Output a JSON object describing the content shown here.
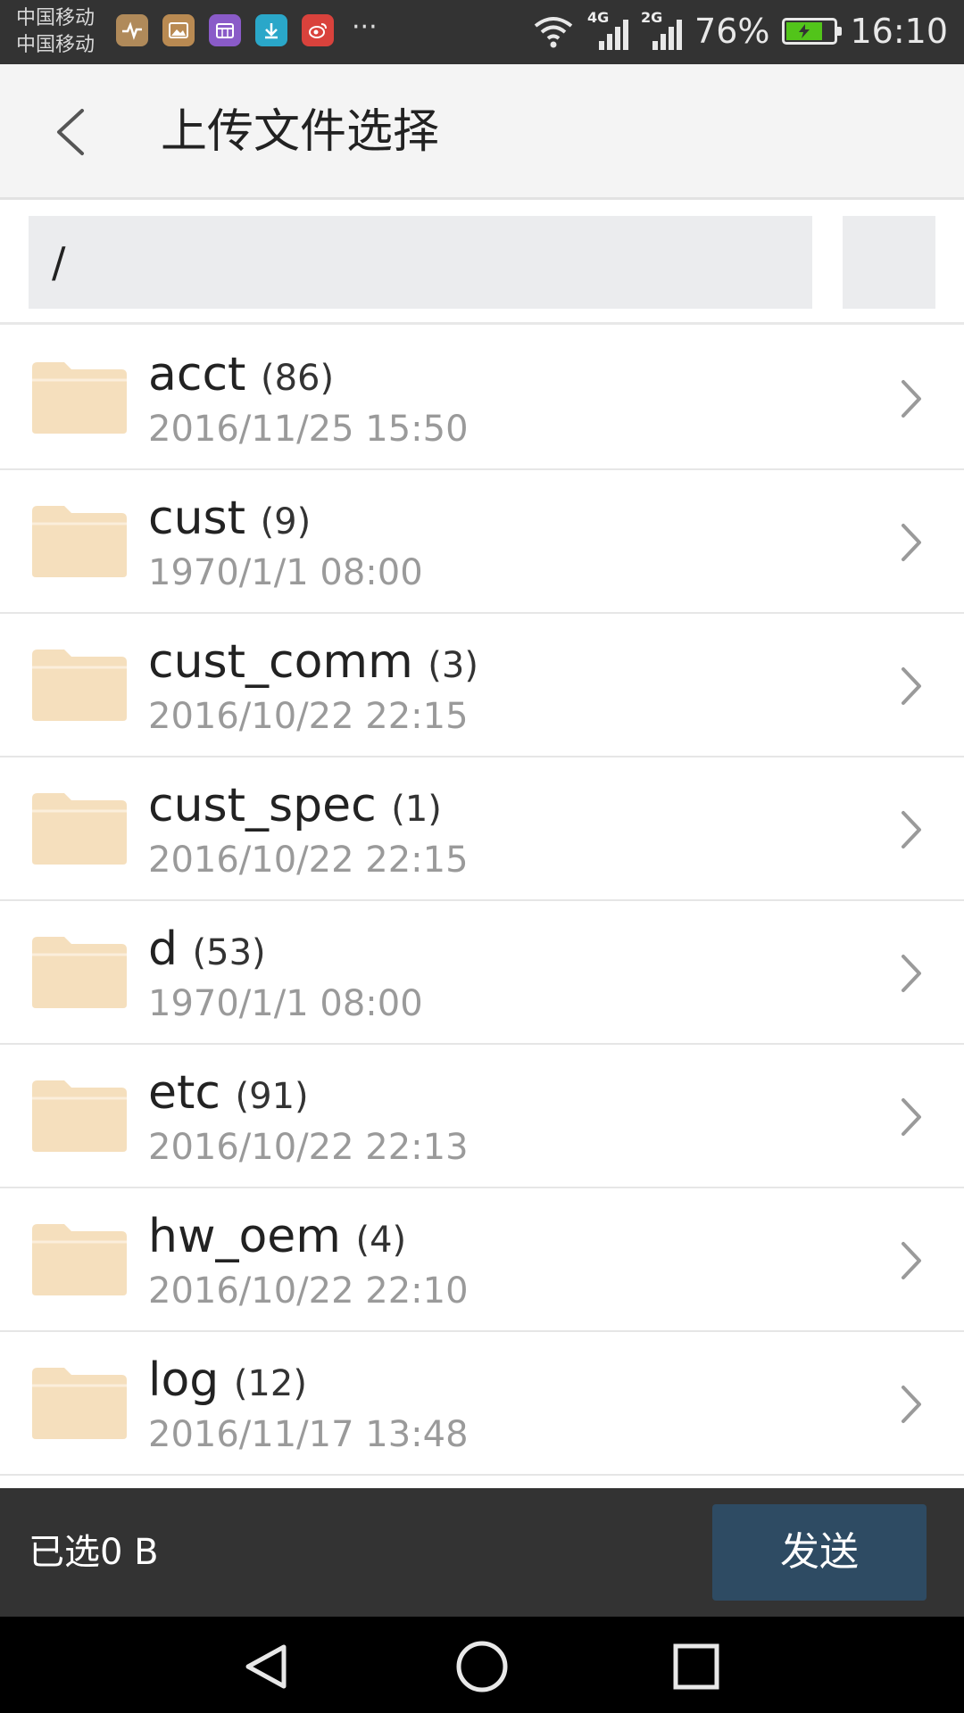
{
  "status_bar": {
    "carrier_1": "中国移动",
    "carrier_2": "中国移动",
    "notification_icons": [
      "health-icon",
      "gallery-icon",
      "calendar-icon",
      "download-icon",
      "weibo-icon"
    ],
    "more": "···",
    "network_1": "4G",
    "network_2": "2G",
    "battery_percent": "76%",
    "battery_level": 0.76,
    "time": "16:10"
  },
  "header": {
    "title": "上传文件选择",
    "back_icon": "back-chevron-icon"
  },
  "path_bar": {
    "current_path": "/"
  },
  "files": [
    {
      "name": "acct",
      "count": "(86)",
      "date": "2016/11/25 15:50"
    },
    {
      "name": "cust",
      "count": "(9)",
      "date": "1970/1/1 08:00"
    },
    {
      "name": "cust_comm",
      "count": "(3)",
      "date": "2016/10/22 22:15"
    },
    {
      "name": "cust_spec",
      "count": "(1)",
      "date": "2016/10/22 22:15"
    },
    {
      "name": "d",
      "count": "(53)",
      "date": "1970/1/1 08:00"
    },
    {
      "name": "etc",
      "count": "(91)",
      "date": "2016/10/22 22:13"
    },
    {
      "name": "hw_oem",
      "count": "(4)",
      "date": "2016/10/22 22:10"
    },
    {
      "name": "log",
      "count": "(12)",
      "date": "2016/11/17 13:48"
    }
  ],
  "action_bar": {
    "selected_size": "已选0 B",
    "send_label": "发送"
  },
  "colors": {
    "status_bg": "#333333",
    "header_bg": "#f4f4f4",
    "folder": "#f5dfbd",
    "send_button": "#2e4b63",
    "battery": "#52c41a"
  }
}
